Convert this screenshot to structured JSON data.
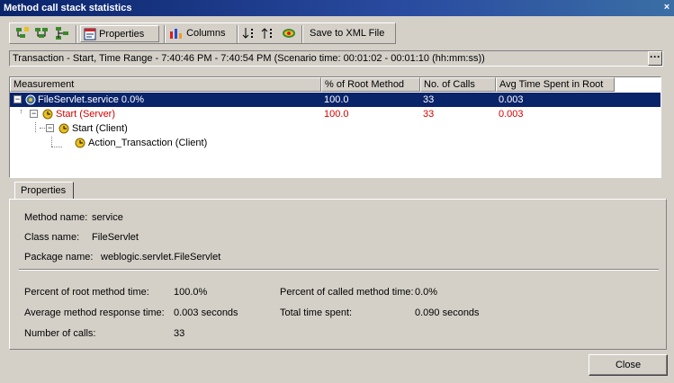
{
  "window": {
    "title": "Method call stack statistics",
    "close_glyph": "×"
  },
  "toolbar": {
    "expand_icon": "expand-tree-icon",
    "collapse_icon": "collapse-tree-icon",
    "tree_icon": "tree-view-icon",
    "properties_label": "Properties",
    "columns_label": "Columns",
    "save_label": "Save to XML File"
  },
  "info": {
    "text": "Transaction - Start, Time Range - 7:40:46 PM - 7:40:54 PM (Scenario time: 00:01:02 - 00:01:10 (hh:mm:ss))",
    "ellipsis": "···"
  },
  "table": {
    "headers": [
      "Measurement",
      "% of Root Method",
      "No. of Calls",
      "Avg Time Spent in Root"
    ],
    "rows": [
      {
        "name": "FileServlet.service  0.0%",
        "pct": "100.0",
        "calls": "33",
        "avg": "0.003"
      },
      {
        "name": "Start (Server)",
        "pct": "100.0",
        "calls": "33",
        "avg": "0.003"
      },
      {
        "name": "Start (Client)",
        "pct": "",
        "calls": "",
        "avg": ""
      },
      {
        "name": "Action_Transaction (Client)",
        "pct": "",
        "calls": "",
        "avg": ""
      }
    ]
  },
  "properties": {
    "tab_label": "Properties",
    "method_name_label": "Method name:",
    "method_name": "service",
    "class_name_label": "Class name:",
    "class_name": "FileServlet",
    "package_name_label": "Package name:",
    "package_name": "weblogic.servlet.FileServlet",
    "root_pct_label": "Percent of root method time:",
    "root_pct": "100.0%",
    "called_pct_label": "Percent of called method time:",
    "called_pct": "0.0%",
    "avg_resp_label": "Average method response time:",
    "avg_resp": "0.003 seconds",
    "total_time_label": "Total time spent:",
    "total_time": "0.090 seconds",
    "calls_label": "Number of calls:",
    "calls": "33"
  },
  "footer": {
    "close_label": "Close"
  },
  "colors": {
    "title_bg": "#0a246a",
    "selected_bg": "#0a246a",
    "highlight_text": "#d40000"
  }
}
